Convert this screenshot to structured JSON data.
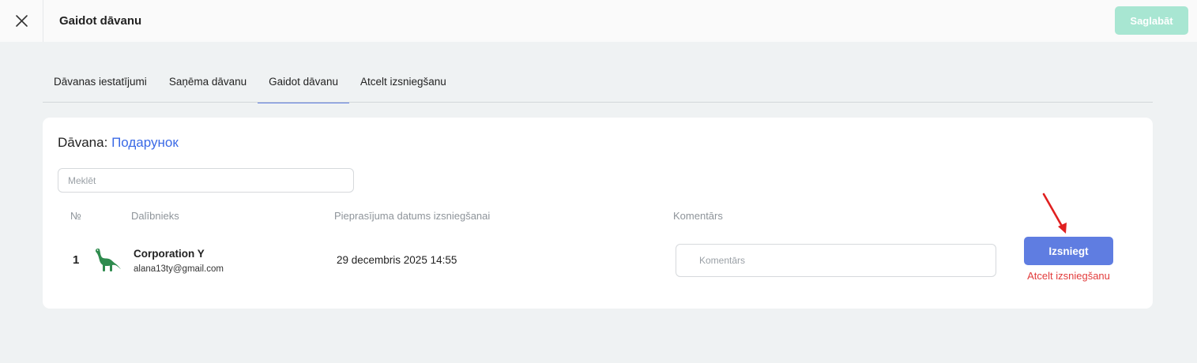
{
  "topbar": {
    "title": "Gaidot dāvanu",
    "save_label": "Saglabāt",
    "close_icon": "close-icon"
  },
  "tabs": [
    {
      "label": "Dāvanas iestatījumi",
      "active": false
    },
    {
      "label": "Saņēma dāvanu",
      "active": false
    },
    {
      "label": "Gaidot dāvanu",
      "active": true
    },
    {
      "label": "Atcelt izsniegšanu",
      "active": false
    }
  ],
  "card": {
    "title_prefix": "Dāvana:",
    "gift_name": "Подарунок",
    "search_placeholder": "Meklēt",
    "columns": {
      "num": "№",
      "participant": "Dalībnieks",
      "date": "Pieprasījuma datums izsniegšanai",
      "comment": "Komentārs"
    },
    "rows": [
      {
        "num": "1",
        "avatar_icon": "dinosaur-icon",
        "name": "Corporation Y",
        "email": "alana13ty@gmail.com",
        "date": "29 decembris 2025 14:55",
        "comment_placeholder": "Komentārs",
        "redeem_label": "Izsniegt",
        "cancel_label": "Atcelt izsniegšanu"
      }
    ]
  },
  "colors": {
    "accent": "#5f7de1",
    "link": "#3b6ae6",
    "danger": "#e23b3b",
    "save_disabled": "#a8e6d2",
    "annotation_arrow": "#e02020"
  }
}
